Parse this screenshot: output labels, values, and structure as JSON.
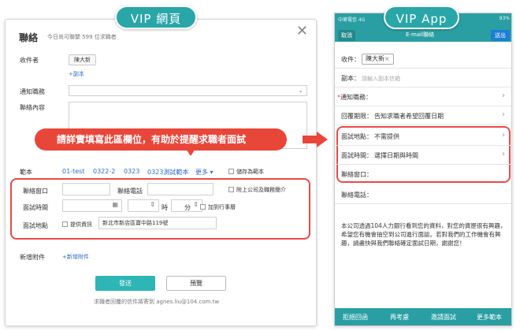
{
  "badges": {
    "web": "VIP 網頁",
    "app": "VIP App"
  },
  "web": {
    "title": "聯絡",
    "subtitle": "今日尚可聯繫 599 位求職者",
    "close_glyph": "✕",
    "recipient_label": "收件者",
    "recipient_chip": "陳大新",
    "cc_link": "+副本",
    "notify_label": "通知職務",
    "select_arrow": "⌄",
    "content_label": "聯絡內容",
    "callout": "請詳實填寫此區欄位，有助於提醒求職者面試",
    "template_label": "範本",
    "templates": [
      "01-test",
      "0322-2",
      "0323",
      "0323測試範本"
    ],
    "more_label": "更多",
    "more_arrow": "▾",
    "save_template": "儲存為範本",
    "contact_window_label": "聯絡窗口",
    "contact_phone_label": "聯絡電話",
    "attach_intro": "附上公司及職務簡介",
    "interview_time_label": "面試時間",
    "calendar_icon": "▦",
    "spin_icon": "⇕",
    "hour_label": "時",
    "minute_label": "分",
    "add_calendar": "加到行事曆",
    "interview_place_label": "面試地點",
    "provide_info": "提供資訊",
    "address": "新北市新店區寶中路119號",
    "attachments_label": "新增附件",
    "add_attachment": "+新增附件",
    "send_label": "發送",
    "preview_label": "預覽",
    "footer_note": "求職者回覆的信件將寄到 agnes.liu@104.com.tw"
  },
  "app": {
    "status_left": "中華電信  4G",
    "status_right": "93%",
    "cancel_label": "取消",
    "title": "E-mail聯絡",
    "send_label": "送出",
    "recipient_label": "收件：",
    "recipient_chip": "陳大新",
    "chip_close": "×",
    "cc_label": "副本：",
    "cc_placeholder": "請輸入副本信箱",
    "required_mark": "*",
    "notify_label": "通知職務：",
    "reply_label": "回覆期限：",
    "reply_value": "告知求職者希望回覆日期",
    "place_label": "面試地點：",
    "place_value": "不需提供",
    "time_label": "面試時間：",
    "time_value": "選擇日期與時間",
    "window_label": "聯絡窗口：",
    "phone_label": "聯絡電話：",
    "chevron": "›",
    "body": "本公司透過104人力銀行看到您的資料，對您的資歷很有興趣，希望您有機會抽空到公司進行面談。若對我們的工作機會有興趣，請盡快與我們聯絡確定面試日期，謝謝您！",
    "tabs": [
      "拒絕回函",
      "再考慮",
      "邀請面試",
      "更多範本"
    ]
  },
  "colors": {
    "teal": "#29a6a8",
    "red": "#e94a44",
    "link": "#2d6fc7"
  }
}
